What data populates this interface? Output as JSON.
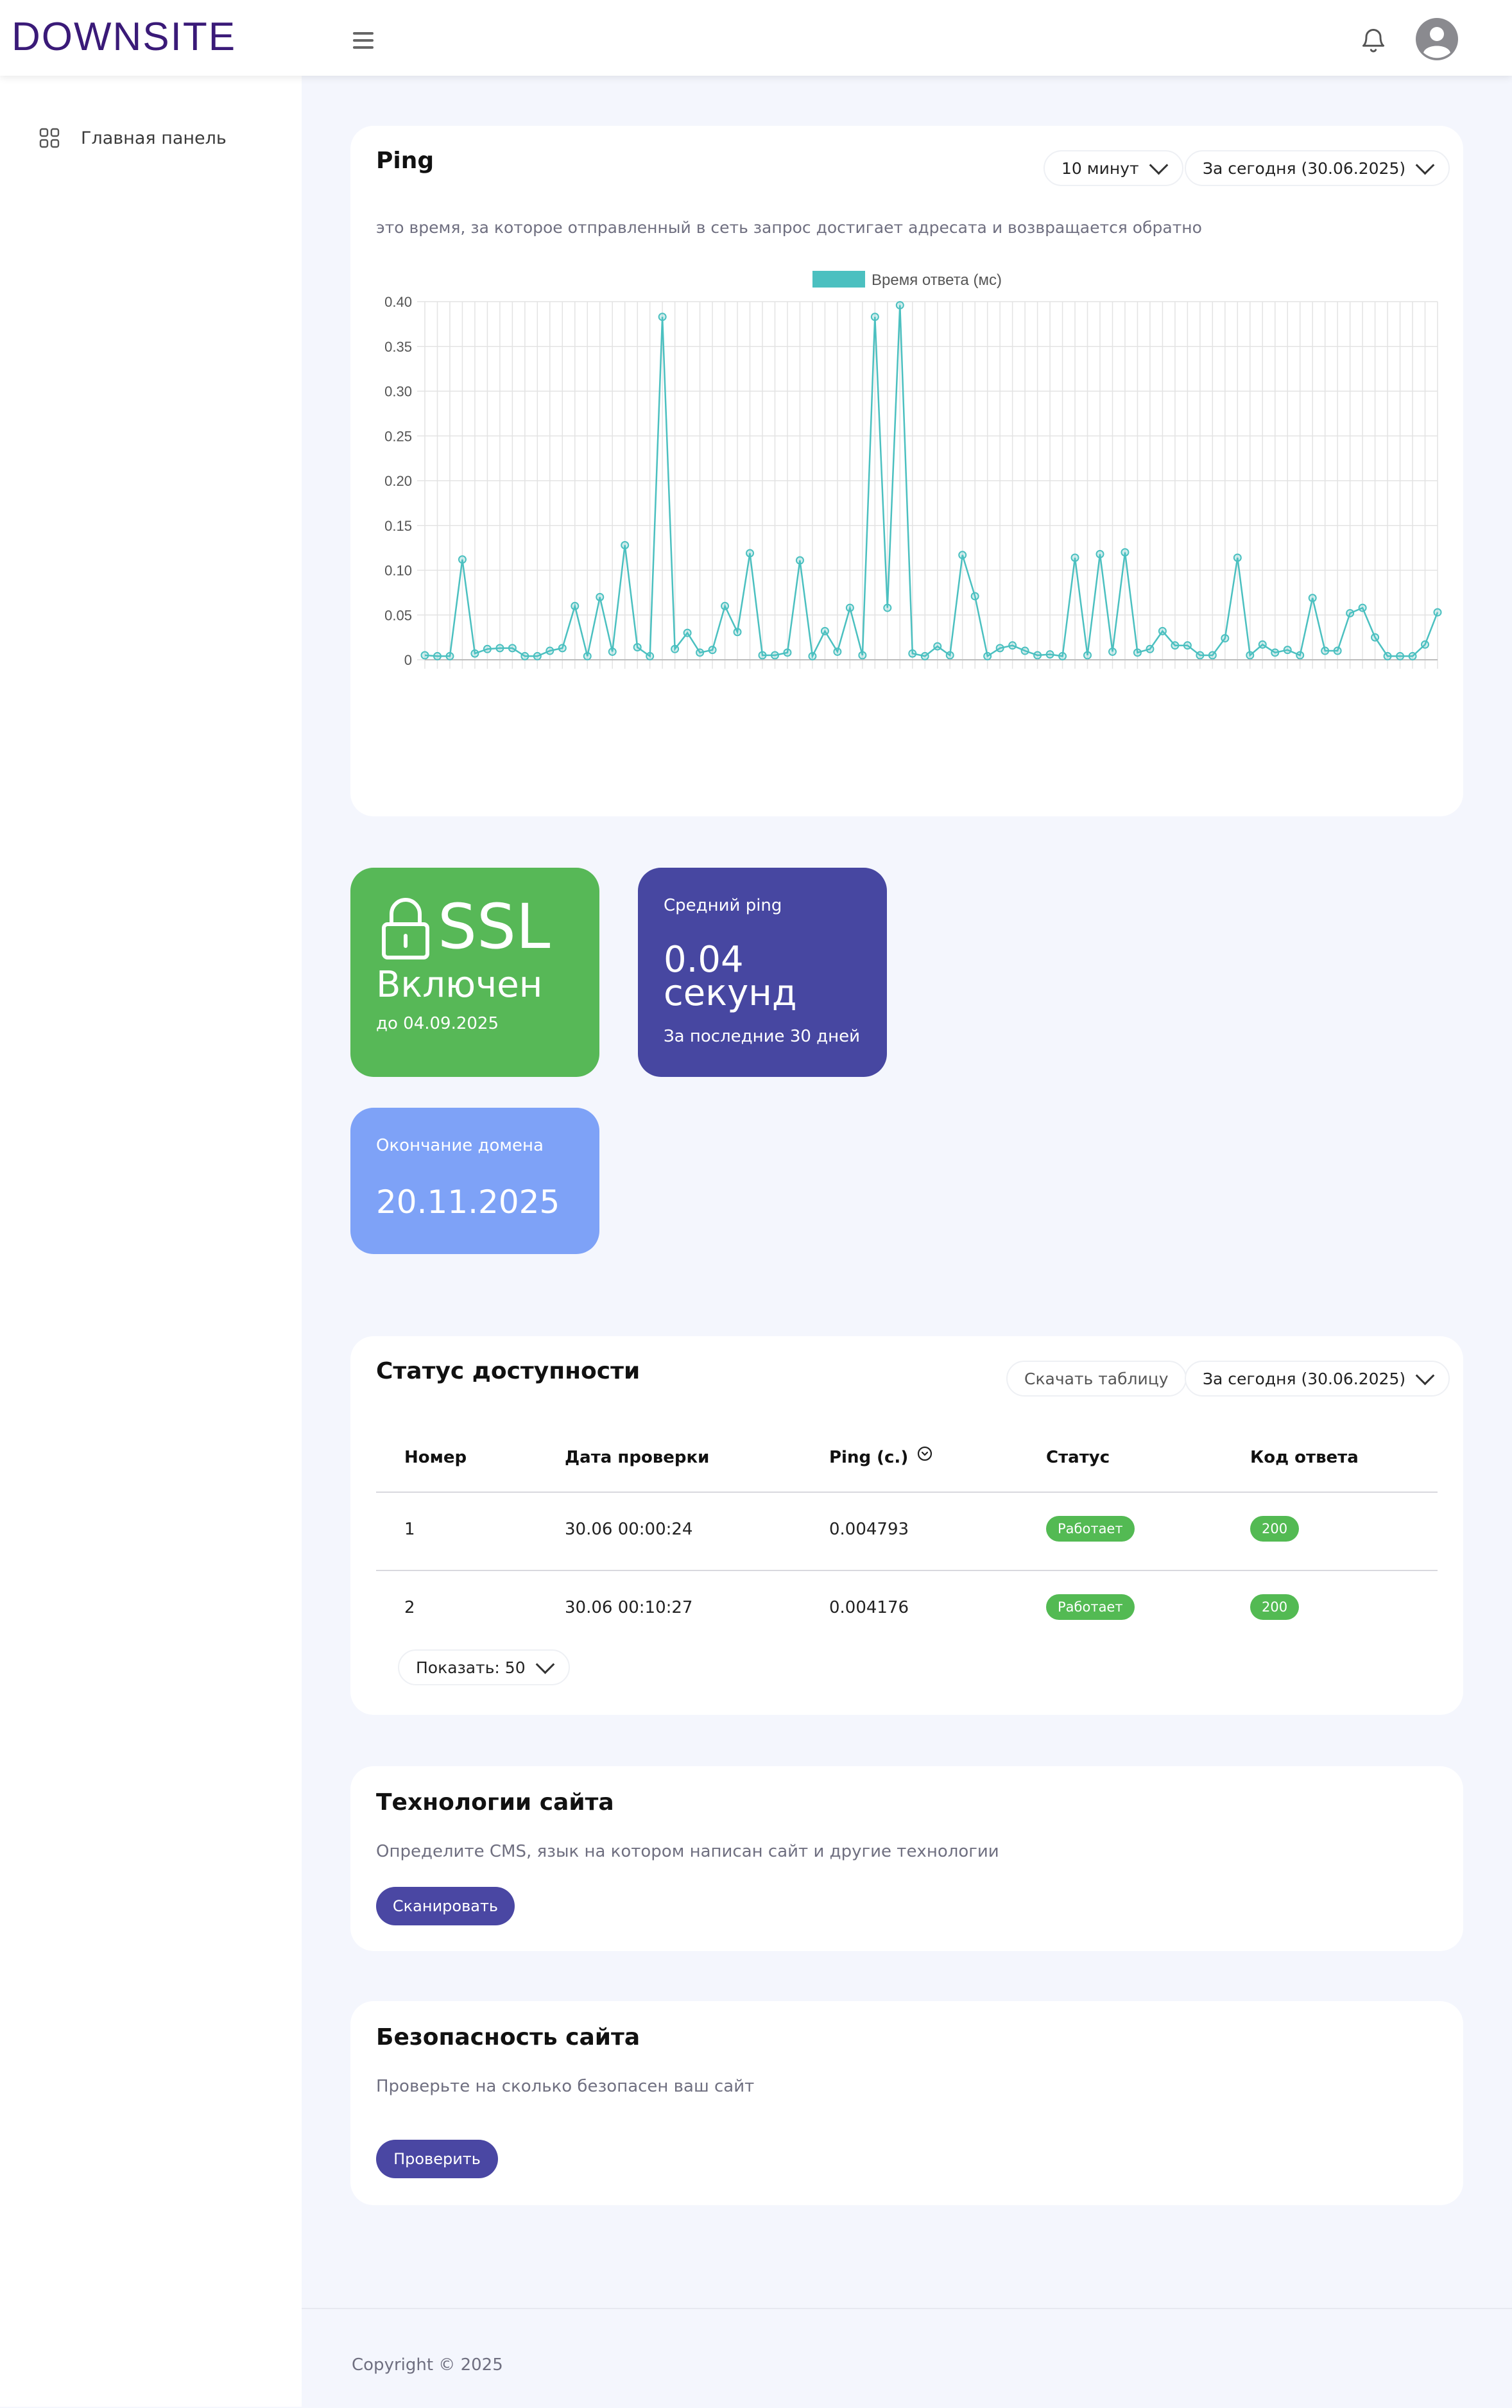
{
  "header": {
    "logo": "DOWNSITE",
    "menu_icon": "hamburger-icon",
    "bell_icon": "bell-icon",
    "avatar_icon": "user-avatar-icon"
  },
  "sidebar": {
    "items": [
      {
        "label": "Главная панель",
        "icon": "grid-icon"
      }
    ]
  },
  "ping": {
    "title": "Ping",
    "interval": "10 минут",
    "period": "За сегодня (30.06.2025)",
    "description": "это время, за которое отправленный в сеть запрос достигает адресата и возвращается обратно",
    "legend": "Время ответа (мс)",
    "legend_color": "#4bc0c0"
  },
  "chart_data": {
    "type": "line",
    "series": [
      {
        "name": "Время ответа (мс)",
        "color": "#4bc0c0",
        "values": [
          0.005,
          0.004,
          0.004,
          0.112,
          0.007,
          0.012,
          0.013,
          0.013,
          0.004,
          0.004,
          0.01,
          0.013,
          0.06,
          0.004,
          0.07,
          0.009,
          0.128,
          0.014,
          0.004,
          0.383,
          0.012,
          0.03,
          0.008,
          0.011,
          0.06,
          0.031,
          0.119,
          0.005,
          0.005,
          0.008,
          0.111,
          0.004,
          0.032,
          0.009,
          0.058,
          0.005,
          0.383,
          0.058,
          0.396,
          0.007,
          0.004,
          0.015,
          0.005,
          0.117,
          0.071,
          0.004,
          0.013,
          0.016,
          0.01,
          0.005,
          0.006,
          0.004,
          0.114,
          0.005,
          0.118,
          0.009,
          0.12,
          0.008,
          0.012,
          0.032,
          0.016,
          0.016,
          0.005,
          0.005,
          0.024,
          0.114,
          0.005,
          0.017,
          0.008,
          0.011,
          0.005,
          0.069,
          0.01,
          0.01,
          0.052,
          0.058,
          0.025,
          0.004,
          0.004,
          0.004,
          0.017,
          0.053
        ]
      }
    ],
    "y_ticks": [
      "0",
      "0.05",
      "0.10",
      "0.15",
      "0.20",
      "0.25",
      "0.30",
      "0.35",
      "0.40"
    ],
    "ylim": [
      0,
      0.4
    ],
    "grid": true,
    "legend_position": "top"
  },
  "ssl": {
    "title": "SSL",
    "status": "Включен",
    "until": "до 04.09.2025",
    "icon": "lock-icon",
    "color": "#57b857"
  },
  "avg_ping": {
    "label": "Средний ping",
    "value": "0.04",
    "unit": "секунд",
    "note": "За последние 30 дней",
    "color": "#4747a1"
  },
  "domain": {
    "label": "Окончание домена",
    "date": "20.11.2025",
    "color": "#7ea2f7"
  },
  "status": {
    "title": "Статус доступности",
    "download_label": "Скачать таблицу",
    "period": "За сегодня (30.06.2025)",
    "columns": [
      "Номер",
      "Дата проверки",
      "Ping (c.)",
      "Статус",
      "Код ответа"
    ],
    "sort_icon": "sort-arrow-icon",
    "rows": [
      {
        "num": "1",
        "date": "30.06 00:00:24",
        "ping": "0.004793",
        "status": "Работает",
        "code": "200"
      },
      {
        "num": "2",
        "date": "30.06 00:10:27",
        "ping": "0.004176",
        "status": "Работает",
        "code": "200"
      }
    ],
    "page_size_label": "Показать: 50"
  },
  "tech": {
    "title": "Технологии сайта",
    "description": "Определите CMS, язык на котором написан сайт и другие технологии",
    "button": "Сканировать"
  },
  "security": {
    "title": "Безопасность сайта",
    "description": "Проверьте на сколько безопасен ваш сайт",
    "button": "Проверить"
  },
  "footer": {
    "copyright": "Copyright © 2025"
  }
}
